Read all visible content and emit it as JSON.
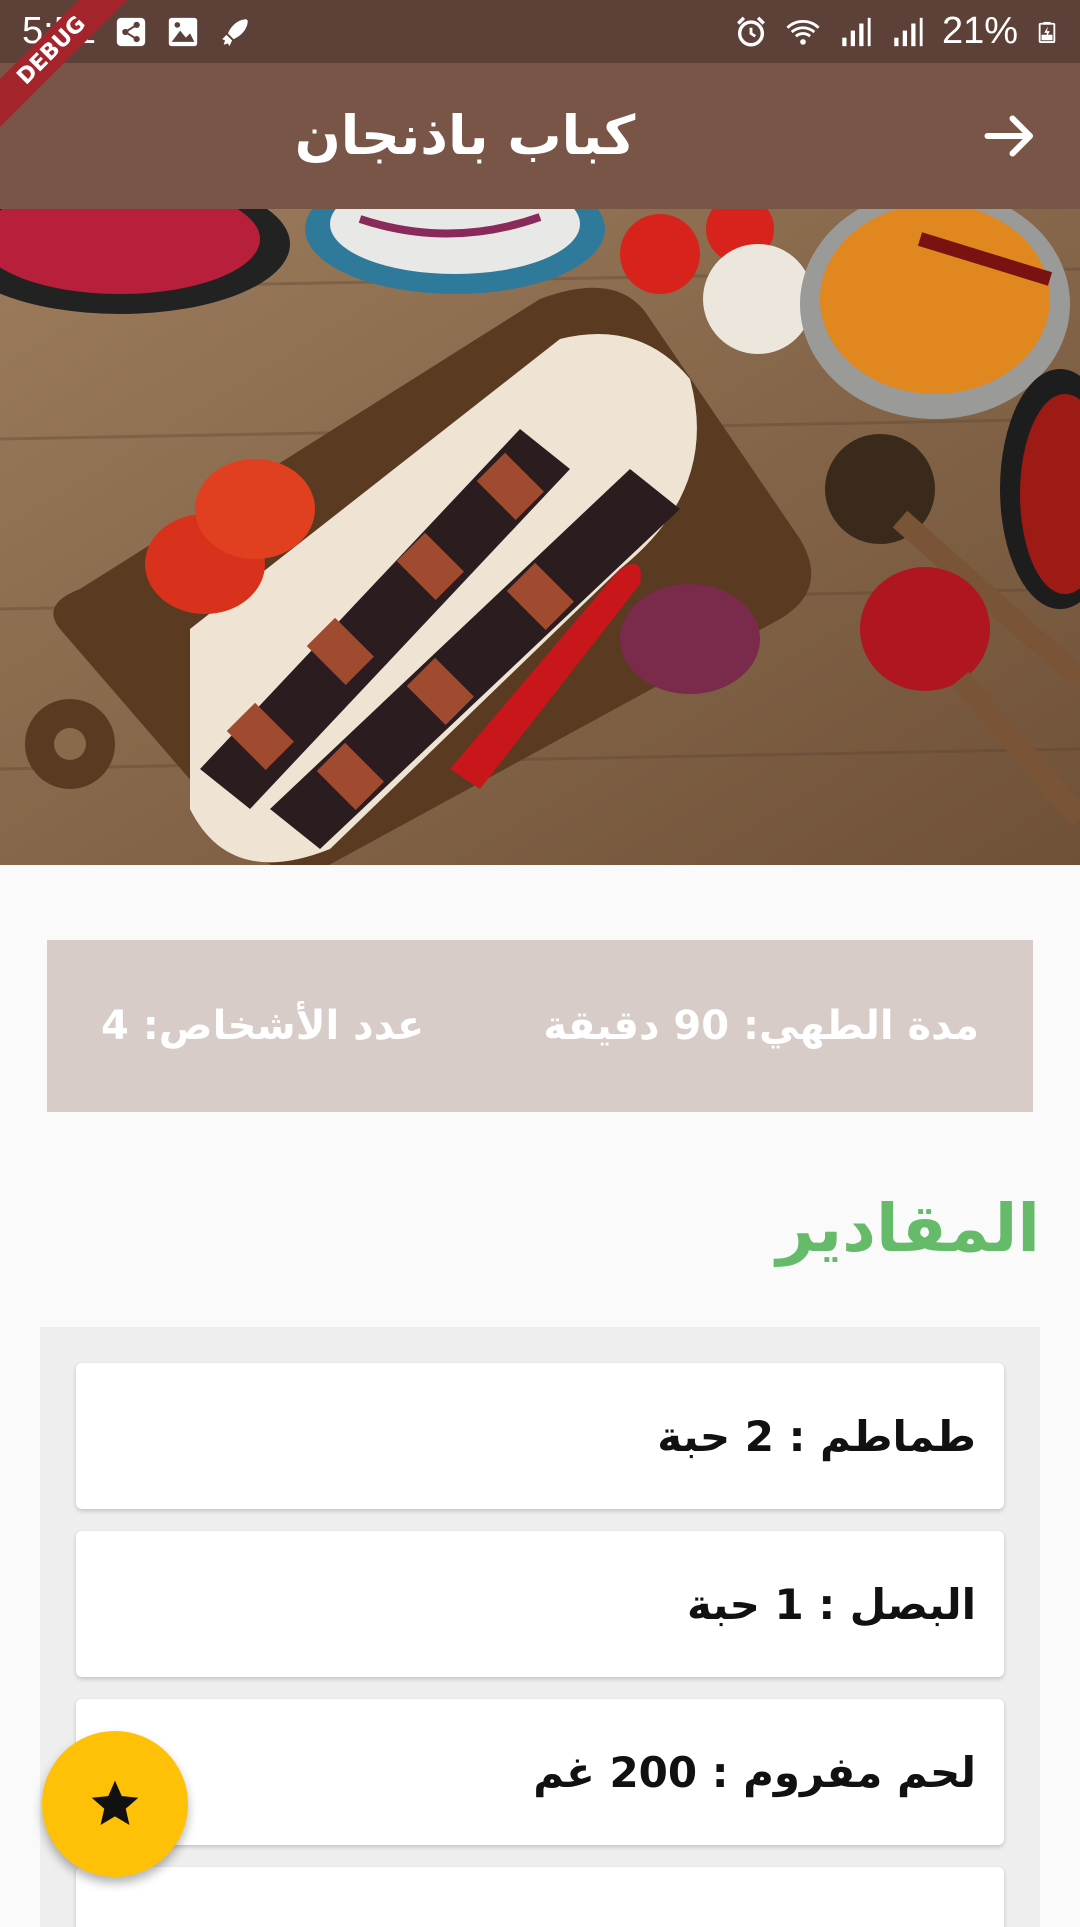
{
  "status_bar": {
    "time": "5:51",
    "battery": "21%",
    "left_icons": [
      "share-icon",
      "image-icon",
      "rocket-icon"
    ],
    "right_icons": [
      "alarm-icon",
      "wifi-icon",
      "signal-icon",
      "signal-icon",
      "battery-icon"
    ]
  },
  "debug_banner": "DEBUG",
  "app_bar": {
    "title": "كباب باذنجان",
    "back_icon": "arrow-forward-icon",
    "background": "#795548"
  },
  "hero_image": {
    "description_icon": "eggplant-kebab-photo"
  },
  "info": {
    "cook_time": "مدة الطهي: 90 دقيقة",
    "servings": "عدد الأشخاص: 4",
    "background": "#d7ccc8"
  },
  "ingredients": {
    "title": "المقادير",
    "title_color": "#66bb6a",
    "items": [
      "طماطم : 2 حبة",
      "البصل : 1 حبة",
      "لحم مفروم : 200 غم",
      ""
    ]
  },
  "fab": {
    "icon": "star-icon",
    "color": "#ffc107"
  }
}
